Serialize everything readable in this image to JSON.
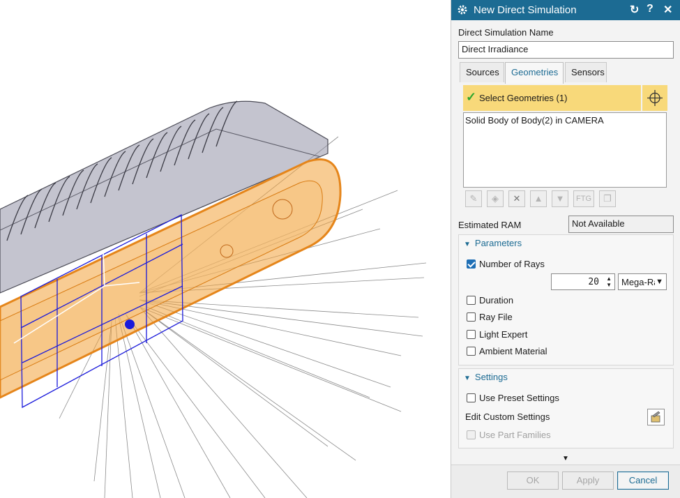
{
  "dialog": {
    "title": "New Direct Simulation",
    "icons": [
      "gear-icon",
      "reset-icon",
      "help-icon",
      "close-icon"
    ],
    "name_label": "Direct Simulation Name",
    "name_value": "Direct Irradiance",
    "tabs": [
      {
        "label": "Sources",
        "active": false
      },
      {
        "label": "Geometries",
        "active": true
      },
      {
        "label": "Sensors",
        "active": false
      }
    ],
    "select_label": "Select Geometries (1)",
    "selected_items": [
      "Solid Body of Body(2) in CAMERA"
    ],
    "toolbar_icons": [
      "add-geometry-icon",
      "filter-icon",
      "delete-icon",
      "move-up-icon",
      "move-down-icon",
      "ftg-icon",
      "copy-icon"
    ],
    "ftg_label": "FTG",
    "ram_label": "Estimated RAM",
    "ram_value": "Not Available",
    "parameters": {
      "header": "Parameters",
      "number_of_rays_label": "Number of Rays",
      "number_of_rays_checked": true,
      "rays_value": "20",
      "rays_unit": "Mega-Rays",
      "options": [
        {
          "label": "Duration",
          "checked": false
        },
        {
          "label": "Ray File",
          "checked": false
        },
        {
          "label": "Light Expert",
          "checked": false
        },
        {
          "label": "Ambient Material",
          "checked": false
        }
      ]
    },
    "settings": {
      "header": "Settings",
      "use_preset_label": "Use Preset Settings",
      "edit_custom_label": "Edit Custom Settings",
      "use_part_families_label": "Use Part Families"
    },
    "buttons": {
      "ok": "OK",
      "apply": "Apply",
      "cancel": "Cancel"
    }
  },
  "colors": {
    "title_bar": "#1c6b93",
    "select_highlight": "#f8d97a",
    "body_orange": "#f2a23a",
    "body_gray": "#8c8ca0",
    "wire_blue": "#1a1adb"
  }
}
